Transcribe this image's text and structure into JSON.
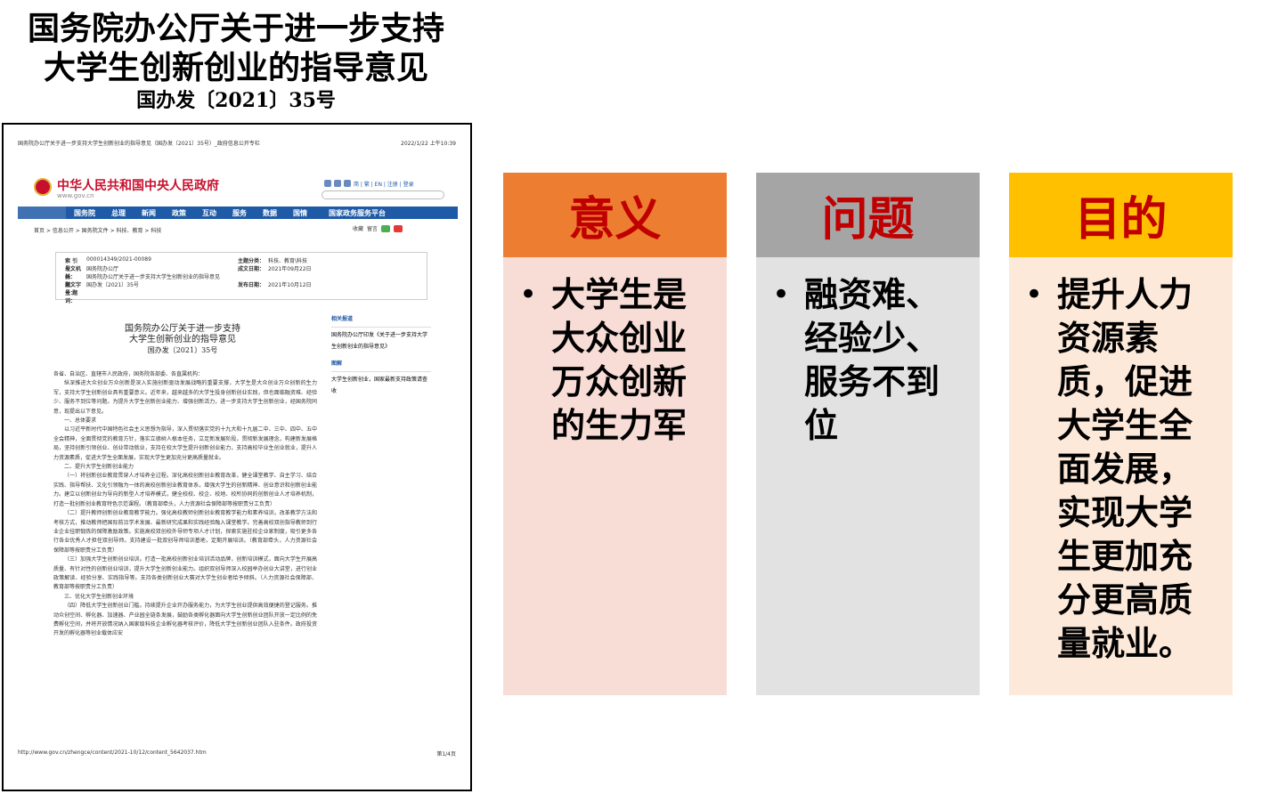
{
  "title": {
    "line1": "国务院办公厅关于进一步支持",
    "line2": "大学生创新创业的指导意见",
    "line3": "国办发〔2021〕35号"
  },
  "document_image": {
    "header_left": "国务院办公厅关于进一步支持大学生创新创业的指导意见（国办发〔2021〕35号）_政府信息公开专栏",
    "header_right": "2022/1/22 上午10:39",
    "site_name": "中华人民共和国中央人民政府",
    "site_url": "www.gov.cn",
    "utility_links": "简 | 繁 | EN | 注册 | 登录",
    "nav": [
      "国务院",
      "总理",
      "新闻",
      "政策",
      "互动",
      "服务",
      "数据",
      "国情",
      "国家政务服务平台"
    ],
    "breadcrumb": "首页 > 信息公开 > 国务院文件 > 科技、教育 > 科技",
    "share_labels": [
      "收藏",
      "留言"
    ],
    "meta": {
      "index_label": "索 引 号：",
      "index_value": "000014349/2021-00089",
      "topic_label": "主题分类：",
      "topic_value": "科技、教育\\科技",
      "issuer_label": "发文机关：",
      "issuer_value": "国务院办公厅",
      "date_label": "成文日期：",
      "date_value": "2021年09月22日",
      "title_label": "标　　题：",
      "title_value": "国务院办公厅关于进一步支持大学生创新创业的指导意见",
      "number_label": "发文字号：",
      "number_value": "国办发〔2021〕35号",
      "publish_label": "发布日期：",
      "publish_value": "2021年10月12日",
      "subject_label": "主 题 词："
    },
    "doc_title_1": "国务院办公厅关于进一步支持",
    "doc_title_2": "大学生创新创业的指导意见",
    "doc_number": "国办发〔2021〕35号",
    "paragraphs": [
      "各省、自治区、直辖市人民政府，国务院各部委、各直属机构：",
      "纵深推进大众创业万众创新是深入实施创新驱动发展战略的重要支撑，大学生是大众创业万众创新的生力军，支持大学生创新创业具有重要意义。近年来，越来越多的大学生投身创新创业实践，但也面临融资难、经验少、服务不到位等问题。为提升大学生创新创业能力、增强创新活力，进一步支持大学生创新创业，经国务院同意，现提出以下意见。",
      "一、总体要求",
      "以习近平新时代中国特色社会主义思想为指导，深入贯彻落实党的十九大和十九届二中、三中、四中、五中全会精神，全面贯彻党的教育方针，落实立德树人根本任务，立足新发展阶段，贯彻新发展理念，构建新发展格局，坚持创新引领创业、创业带动就业，支持在校大学生提升创新创业能力，支持高校毕业生创业就业，提升人力资源素质，促进大学生全面发展，实现大学生更加充分更高质量就业。",
      "二、提升大学生创新创业能力",
      "（一）将创新创业教育贯穿人才培养全过程。深化高校创新创业教育改革，健全课堂教学、自主学习、结合实践、指导帮扶、文化引领融为一体的高校创新创业教育体系，增强大学生的创新精神、创业意识和创新创业能力。建立以创新创业为导向的新型人才培养模式，健全校校、校企、校地、校所协同的创新创业人才培养机制，打造一批创新创业教育特色示范课程。（教育部牵头，人力资源社会保障部等按职责分工负责）",
      "（二）提升教师创新创业教育教学能力。强化高校教师创新创业教育教学能力和素养培训，改革教学方法和考核方式，推动教师把国际前沿学术发展、最新研究成果和实践经验融入课堂教学。完善高校双创指导教师到行业企业挂职锻炼的保障激励政策。实施高校双创校外导师专项人才计划，探索实施驻校企业家制度，吸引更多各行各业优秀人才担任双创导师。支持建设一批双创导师培训基地，定期开展培训。（教育部牵头，人力资源社会保障部等按职责分工负责）",
      "（三）加强大学生创新创业培训。打造一批高校创新创业培训活动品牌，创新培训模式，面向大学生开展高质量、有针对性的创新创业培训，提升大学生创新创业能力。组织双创导师深入校园举办创业大讲堂，进行创业政策解读、经验分享、实践指导等。支持各类创新创业大赛对大学生创业者给予倾斜。（人力资源社会保障部、教育部等按职责分工负责）",
      "三、优化大学生创新创业环境",
      "（四）降低大学生创新创业门槛。持续提升企业开办服务能力，为大学生创业提供高效便捷的登记服务。推动众创空间、孵化器、加速器、产业园全链条发展，鼓励各类孵化器面向大学生创新创业团队开放一定比例的免费孵化空间，并将开放情况纳入国家级科技企业孵化器考核评价，降低大学生创新创业团队入驻条件。政府投资开发的孵化器等创业载体应安"
    ],
    "sidebar_heading_1": "相关报道",
    "sidebar_item_1": "国务院办公厅印发《关于进一步支持大学生创新创业的指导意见》",
    "sidebar_heading_2": "图解",
    "sidebar_item_2": "大学生创新创业，国家最新支持政策请查收",
    "footer_left": "http://www.gov.cn/zhengce/content/2021-10/12/content_5642037.htm",
    "footer_right": "第1/4页"
  },
  "cards": [
    {
      "heading": "意义",
      "text": "大学生是大众创业万众创新的生力军",
      "head_color": "#ed7d31",
      "body_color": "#f8dcd6"
    },
    {
      "heading": "问题",
      "text": "融资难、经验少、服务不到位",
      "head_color": "#a5a5a5",
      "body_color": "#e2e2e2"
    },
    {
      "heading": "目的",
      "text": "提升人力资源素质，促进大学生全面发展，实现大学生更加充分更高质量就业。",
      "head_color": "#ffc000",
      "body_color": "#fde9d9"
    }
  ],
  "bullet_symbol": "•"
}
